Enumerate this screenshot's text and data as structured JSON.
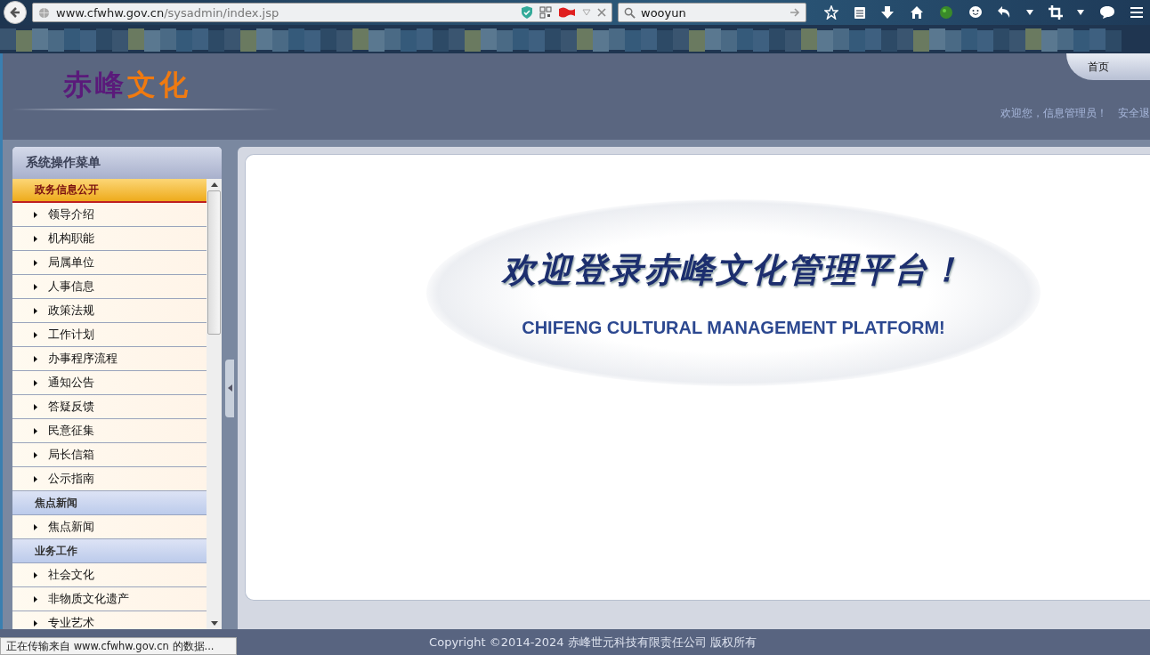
{
  "browser": {
    "url_host": "www.cfwhw.gov.cn",
    "url_path": "/sysadmin/index.jsp",
    "search_value": "wooyun"
  },
  "header": {
    "logo": [
      {
        "text": "赤峰",
        "color": "#5a1a7a"
      },
      {
        "text": "文化",
        "color": "#f07a10"
      }
    ],
    "nav_tab": "首页",
    "welcome": "欢迎您，信息管理员！",
    "logout": "安全退"
  },
  "sidebar": {
    "title": "系统操作菜单",
    "sections": [
      {
        "title": "政务信息公开",
        "selected": true,
        "items": [
          "领导介绍",
          "机构职能",
          "局属单位",
          "人事信息",
          "政策法规",
          "工作计划",
          "办事程序流程",
          "通知公告",
          "答疑反馈",
          "民意征集",
          "局长信箱",
          "公示指南"
        ]
      },
      {
        "title": "焦点新闻",
        "selected": false,
        "items": [
          "焦点新闻"
        ]
      },
      {
        "title": "业务工作",
        "selected": false,
        "items": [
          "社会文化",
          "非物质文化遗产",
          "专业艺术"
        ]
      }
    ]
  },
  "content": {
    "headline": "欢迎登录赤峰文化管理平台！",
    "subtitle": "CHIFENG CULTURAL MANAGEMENT PLATFORM!"
  },
  "footer": {
    "copyright": "Copyright ©2014-2024 赤峰世元科技有限责任公司 版权所有"
  },
  "status_bar": {
    "text": "正在传输来自 www.cfwhw.gov.cn 的数据..."
  }
}
